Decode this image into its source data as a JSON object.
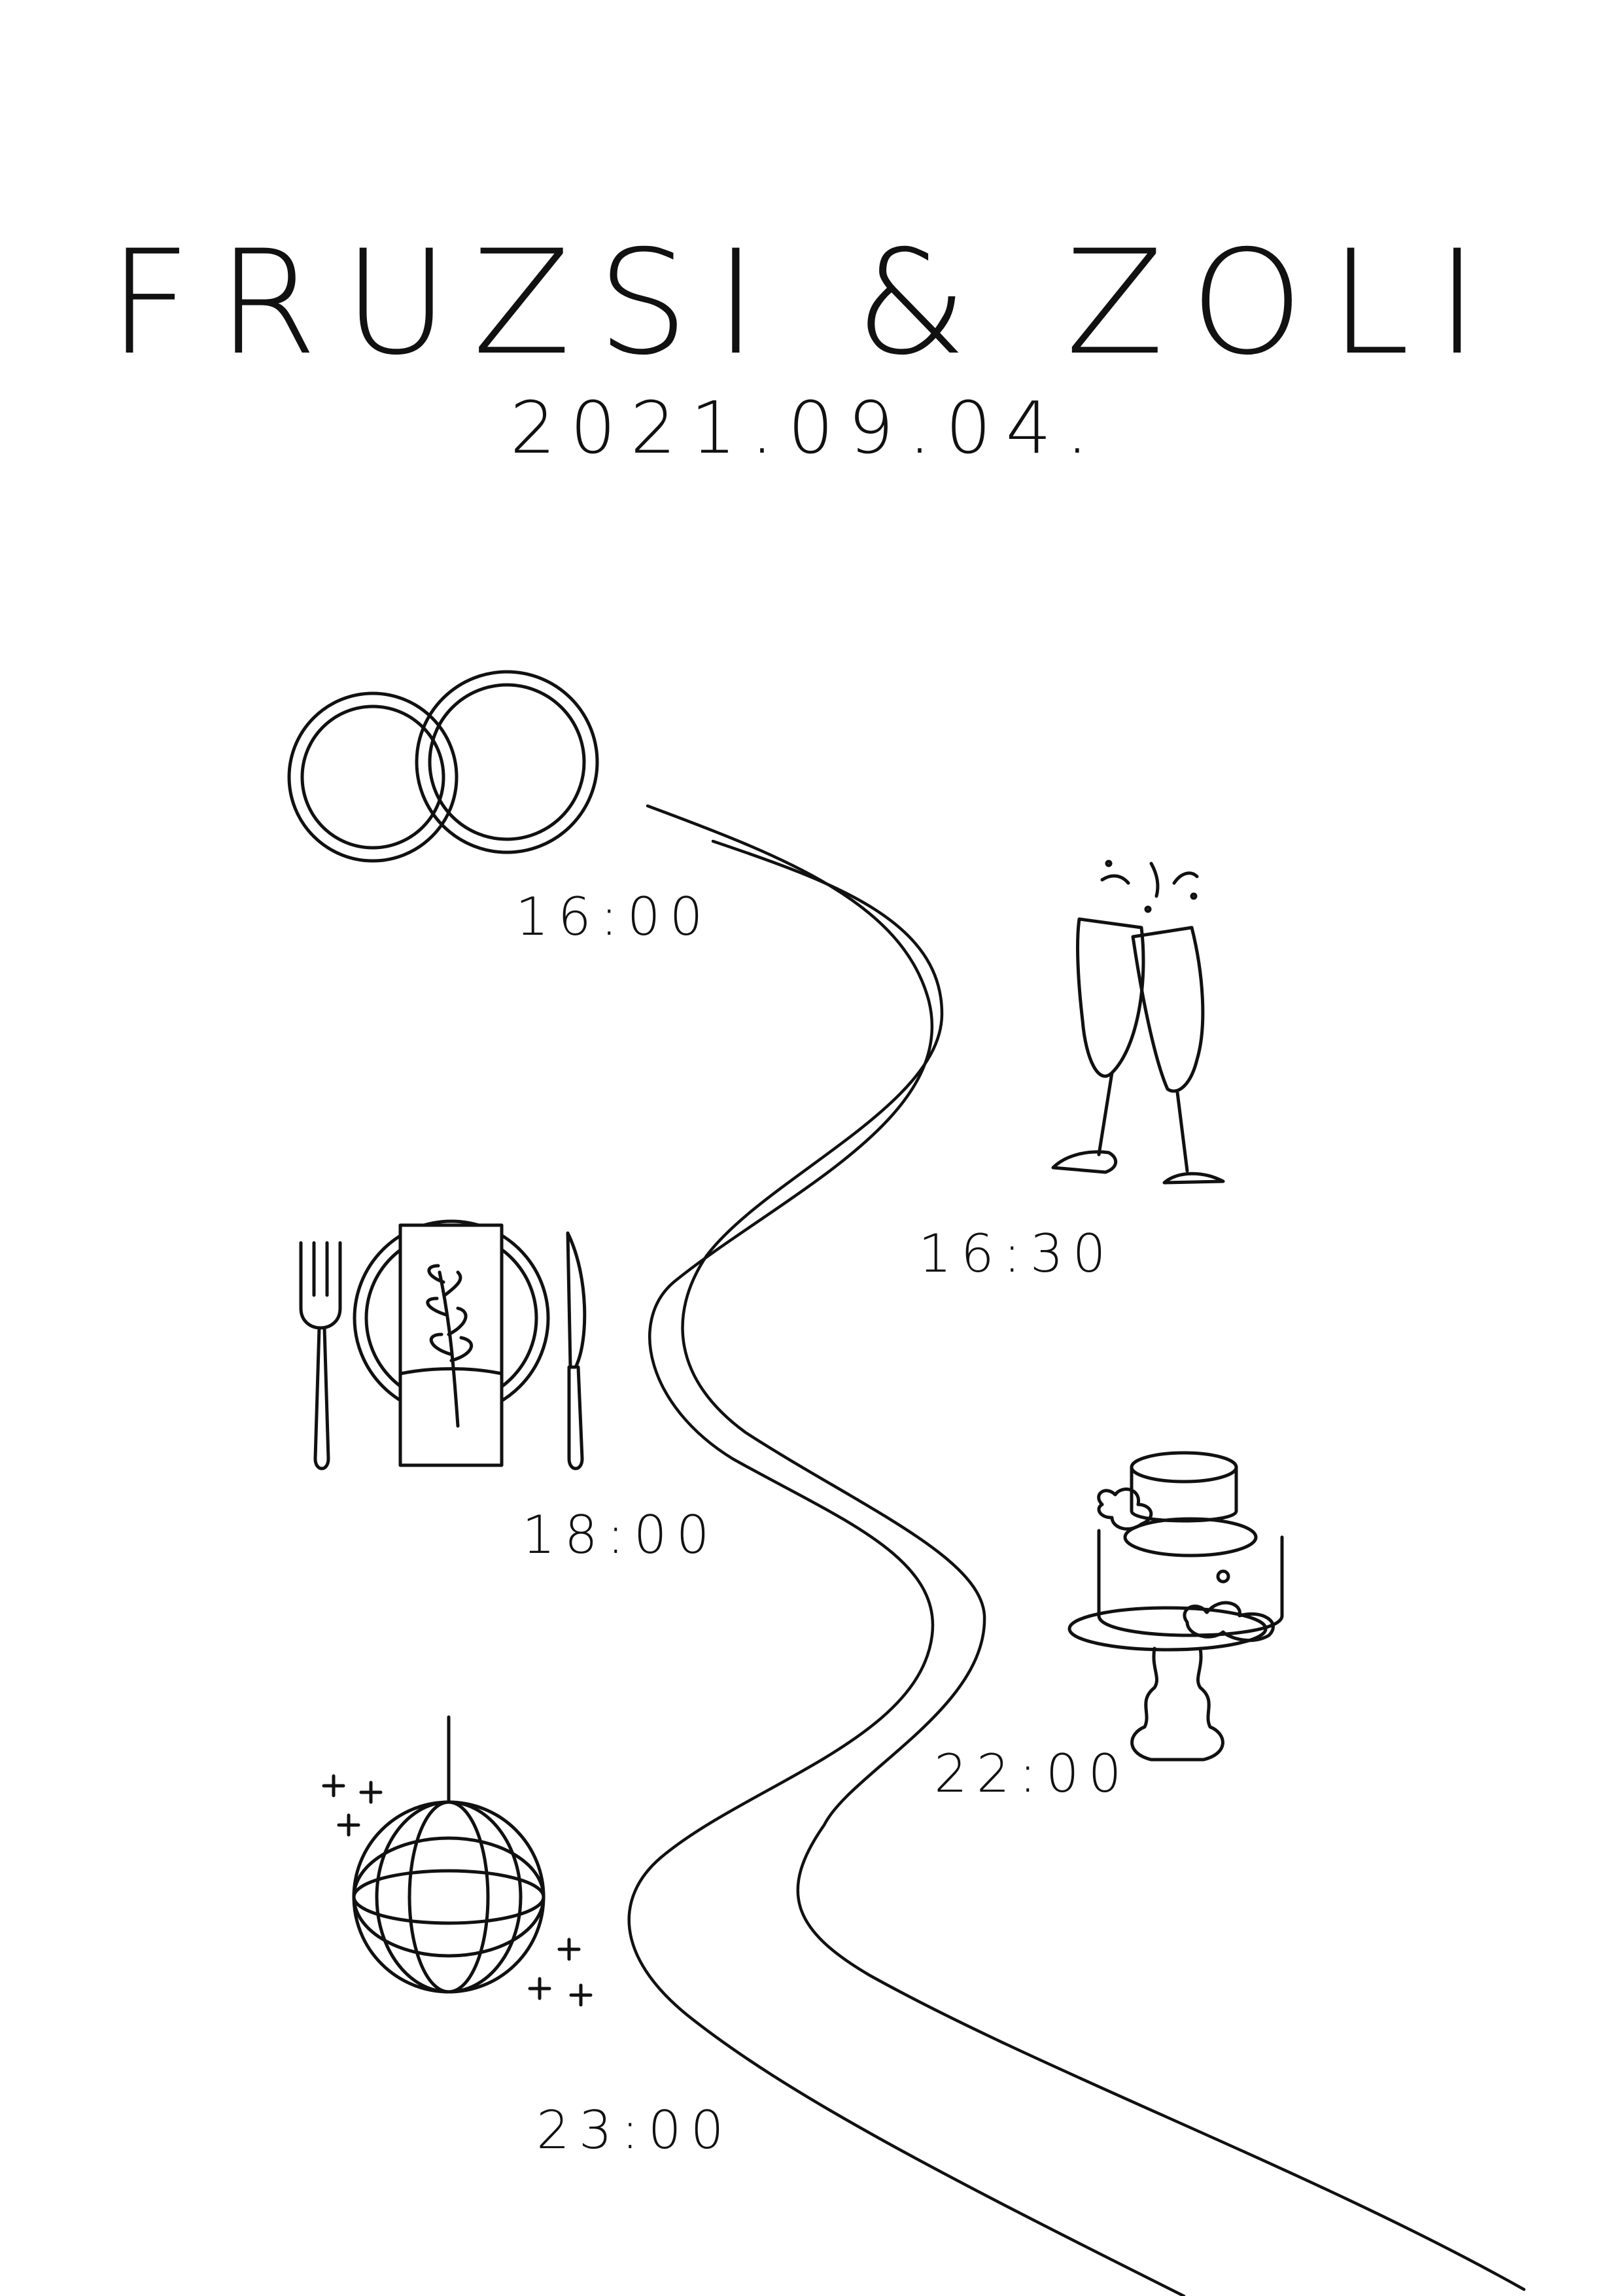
{
  "header": {
    "title": "FRUZSI & ZOLI",
    "date": "2021.09.04."
  },
  "timeline": [
    {
      "time": "16:00",
      "icon": "rings-icon"
    },
    {
      "time": "16:30",
      "icon": "champagne-glasses-icon"
    },
    {
      "time": "18:00",
      "icon": "place-setting-icon"
    },
    {
      "time": "22:00",
      "icon": "wedding-cake-icon"
    },
    {
      "time": "23:00",
      "icon": "disco-ball-icon"
    }
  ],
  "colors": {
    "ink": "#111111",
    "background": "#ffffff"
  }
}
